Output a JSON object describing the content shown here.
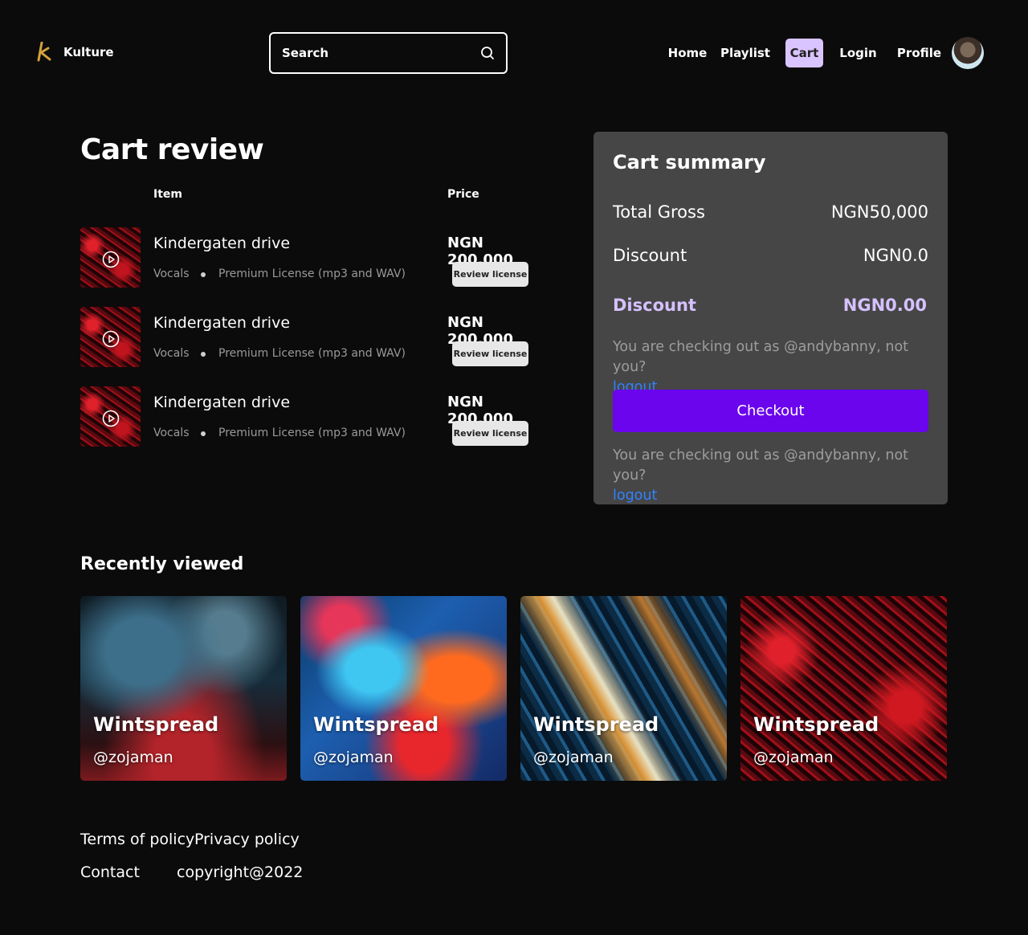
{
  "header": {
    "brand": "Kulture",
    "search": {
      "placeholder": "Search"
    },
    "nav": [
      "Home",
      "Playlist",
      "Cart",
      "Login",
      "Profile"
    ],
    "active_nav": "Cart",
    "accent_color": "#d9c4ff"
  },
  "cart": {
    "title": "Cart review",
    "columns": {
      "item": "Item",
      "price": "Price"
    },
    "items": [
      {
        "name": "Kindergaten drive",
        "type": "Vocals",
        "license": "Premium License (mp3 and WAV)",
        "price": "NGN 200,000",
        "action": "Review license"
      },
      {
        "name": "Kindergaten drive",
        "type": "Vocals",
        "license": "Premium License (mp3 and WAV)",
        "price": "NGN 200,000",
        "action": "Review license"
      },
      {
        "name": "Kindergaten drive",
        "type": "Vocals",
        "license": "Premium License (mp3 and WAV)",
        "price": "NGN 200,000",
        "action": "Review license"
      }
    ]
  },
  "summary": {
    "title": "Cart summary",
    "total_gross_label": "Total Gross",
    "total_gross_value": "NGN50,000",
    "discount_label": "Discount",
    "discount_value": "NGN0.0",
    "discount2_label": "Discount",
    "discount2_value": "NGN0.00",
    "note": "You are checking out as @andybanny, not you?",
    "logout": "logout",
    "checkout": "Checkout",
    "checkout_color": "#6a05ee"
  },
  "recently_viewed": {
    "title": "Recently viewed",
    "cards": [
      {
        "title": "Wintspread",
        "handle": "@zojaman"
      },
      {
        "title": "Wintspread",
        "handle": "@zojaman"
      },
      {
        "title": "Wintspread",
        "handle": "@zojaman"
      },
      {
        "title": "Wintspread",
        "handle": "@zojaman"
      }
    ]
  },
  "footer": {
    "terms": "Terms of policy",
    "privacy": "Privacy policy",
    "contact": "Contact",
    "copyright": "copyright@2022"
  }
}
